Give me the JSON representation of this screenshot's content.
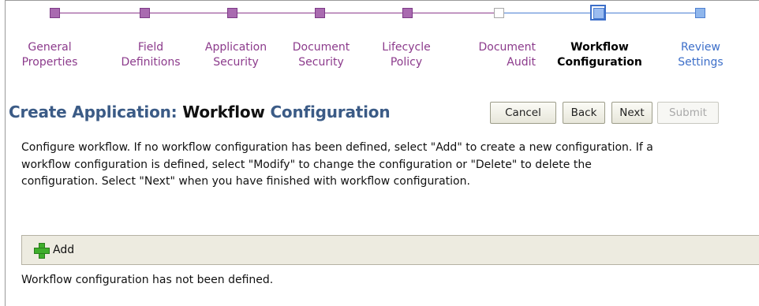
{
  "train": {
    "steps": [
      {
        "line1": "General",
        "line2": "Properties",
        "state": "done"
      },
      {
        "line1": "Field",
        "line2": "Definitions",
        "state": "done"
      },
      {
        "line1": "Application",
        "line2": "Security",
        "state": "done"
      },
      {
        "line1": "Document",
        "line2": "Security",
        "state": "done"
      },
      {
        "line1": "Lifecycle",
        "line2": "Policy",
        "state": "done"
      },
      {
        "line1": "Document",
        "line2": "Audit",
        "state": "future"
      },
      {
        "line1": "Workflow",
        "line2": "Configuration",
        "state": "current"
      },
      {
        "line1": "Review",
        "line2": "Settings",
        "state": "todo"
      }
    ]
  },
  "header": {
    "title_prefix": "Create Application:",
    "title_emph": "Workflow",
    "title_suffix": "Configuration",
    "buttons": {
      "cancel": "Cancel",
      "back": "Back",
      "next": "Next",
      "submit": "Submit"
    }
  },
  "description": "Configure workflow. If no workflow configuration has been defined, select \"Add\" to create a new configuration. If a workflow configuration is defined, select \"Modify\" to change the configuration or \"Delete\" to delete the configuration. Select \"Next\" when you have finished with workflow configuration.",
  "toolbar": {
    "add_label": "Add",
    "add_icon": "plus-icon"
  },
  "status": "Workflow configuration has not been defined.",
  "colors": {
    "visited": "#8c3b8c",
    "title": "#3b5b86",
    "upcoming": "#3d6fc9",
    "toolbar_bg": "#edebe0"
  }
}
